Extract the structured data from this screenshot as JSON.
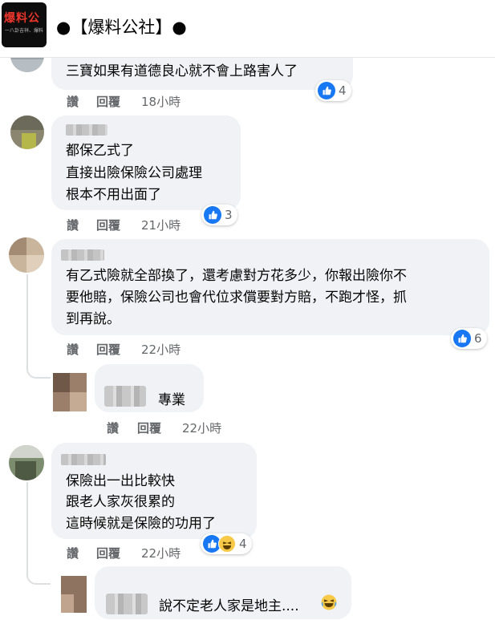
{
  "header": {
    "logo_text": "爆料公",
    "logo_subtext": "一八卦吉祥、爆料",
    "page_name": "●【爆料公社】●"
  },
  "comments": [
    {
      "text": [
        "三寶如果有道德良心就不會上路害人了"
      ],
      "actions": {
        "like": "讚",
        "reply": "回覆",
        "time": "18小時"
      },
      "reactions": {
        "count": "4"
      }
    },
    {
      "text": [
        "都保乙式了",
        "直接出險保險公司處理",
        "根本不用出面了"
      ],
      "actions": {
        "like": "讚",
        "reply": "回覆",
        "time": "21小時"
      },
      "reactions": {
        "count": "3"
      }
    },
    {
      "text": [
        "有乙式險就全部換了，還考慮對方花多少，你報出險你不",
        "要他賠，保險公司也會代位求償要對方賠，不跑才怪，抓",
        "到再說。"
      ],
      "actions": {
        "like": "讚",
        "reply": "回覆",
        "time": "22小時"
      },
      "reactions": {
        "count": "6"
      }
    },
    {
      "text": [
        "保險出一出比較快",
        "跟老人家灰很累的",
        "這時候就是保險的功用了"
      ],
      "actions": {
        "like": "讚",
        "reply": "回覆",
        "time": "22小時"
      },
      "reactions": {
        "count": "4"
      }
    }
  ],
  "replies": [
    {
      "text": "專業",
      "actions": {
        "like": "讚",
        "reply": "回覆",
        "time": "22小時"
      }
    },
    {
      "text": "說不定老人家是地主...."
    }
  ]
}
